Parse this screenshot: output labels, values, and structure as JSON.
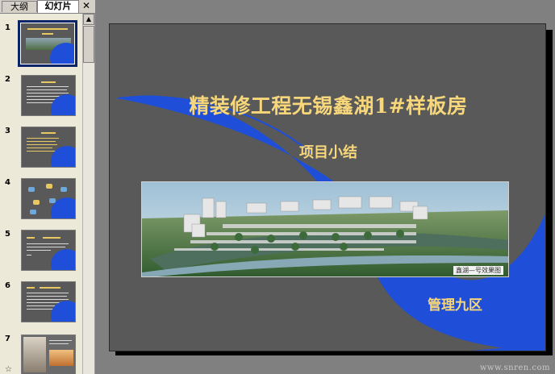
{
  "tabs": [
    {
      "label": "大纲",
      "active": false
    },
    {
      "label": "幻灯片",
      "active": true
    }
  ],
  "close_glyph": "✕",
  "thumbnails": [
    {
      "number": "1",
      "selected": true
    },
    {
      "number": "2",
      "selected": false
    },
    {
      "number": "3",
      "selected": false
    },
    {
      "number": "4",
      "selected": false
    },
    {
      "number": "5",
      "selected": false
    },
    {
      "number": "6",
      "selected": false
    },
    {
      "number": "7",
      "selected": false
    }
  ],
  "star_glyph": "☆",
  "slide": {
    "title": "精装修工程无锡鑫湖1#样板房",
    "subtitle": "项目小结",
    "photo_caption": "鑫湖—号效果图",
    "department": "管理九区"
  },
  "watermark": "www.snren.com",
  "colors": {
    "slide_bg": "#595959",
    "title_gold": "#f7d77a",
    "accent_blue": "#1f4fd8",
    "selected_border": "#0a246a"
  }
}
